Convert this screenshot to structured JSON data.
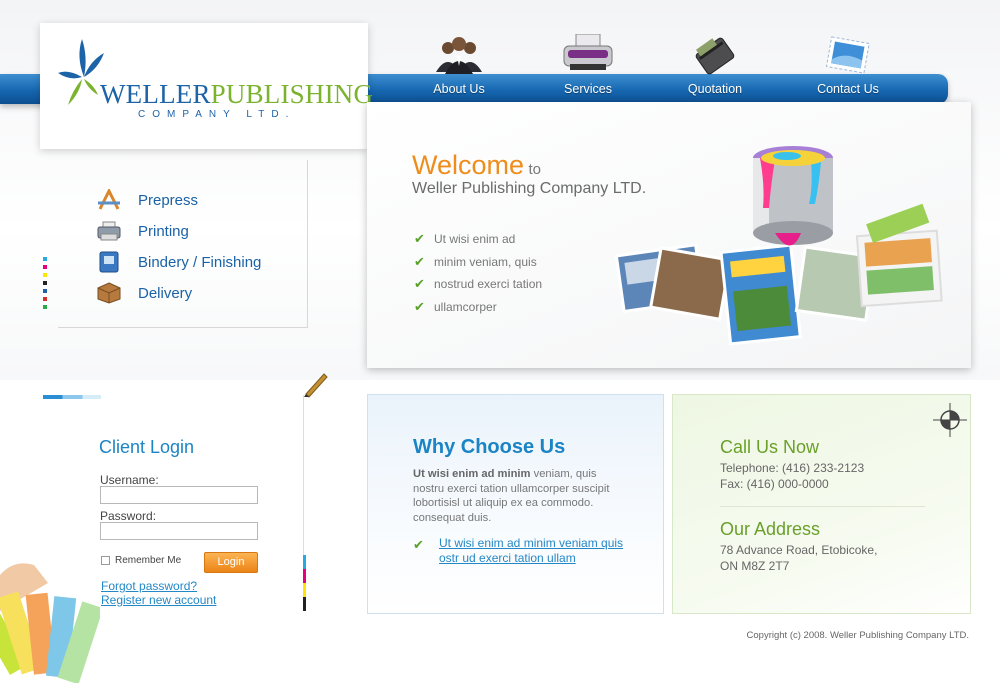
{
  "logo": {
    "name_part1": "Weller",
    "name_part2": "Publishing",
    "subtitle": "COMPANY LTD."
  },
  "nav": {
    "items": [
      {
        "label": "About Us",
        "icon": "people-icon"
      },
      {
        "label": "Services",
        "icon": "printer-icon"
      },
      {
        "label": "Quotation",
        "icon": "wallet-icon"
      },
      {
        "label": "Contact Us",
        "icon": "stamp-icon"
      }
    ]
  },
  "services": {
    "items": [
      {
        "label": "Prepress",
        "icon": "pen-tool-icon"
      },
      {
        "label": "Printing",
        "icon": "printer-icon"
      },
      {
        "label": "Bindery / Finishing",
        "icon": "book-icon"
      },
      {
        "label": "Delivery",
        "icon": "box-icon"
      }
    ]
  },
  "welcome": {
    "title_big": "Welcome",
    "title_to": "to",
    "subtitle": "Weller Publishing Company LTD.",
    "bullets": [
      "Ut wisi enim ad",
      "minim veniam, quis",
      "nostrud exerci tation",
      "ullamcorper"
    ]
  },
  "login": {
    "title": "Client Login",
    "username_label": "Username:",
    "username_value": "",
    "password_label": "Password:",
    "password_value": "",
    "remember_label": "Remember Me",
    "button_label": "Login",
    "forgot_link": "Forgot password?",
    "register_link": "Register new account"
  },
  "why": {
    "title": "Why Choose Us",
    "text_bold": "Ut wisi enim ad minim",
    "text_rest": " veniam, quis nostru exerci tation ullamcorper suscipit lobortisisl ut aliquip ex ea commodo. consequat duis.",
    "link": "Ut wisi enim ad minim veniam quis ostr ud exerci tation ullam"
  },
  "contact": {
    "call_title": "Call Us Now",
    "telephone": "Telephone: (416) 233-2123",
    "fax": "Fax: (416) 000-0000",
    "address_title": "Our Address",
    "address_line1": "78 Advance Road, Etobicoke,",
    "address_line2": "ON M8Z 2T7"
  },
  "footer": {
    "copyright": "Copyright (c) 2008. Weller Publishing Company LTD."
  },
  "colors": {
    "brand_blue": "#1c63a8",
    "brand_green": "#7bb32e",
    "accent_orange": "#ef8d1c",
    "link_blue": "#2488c6"
  }
}
